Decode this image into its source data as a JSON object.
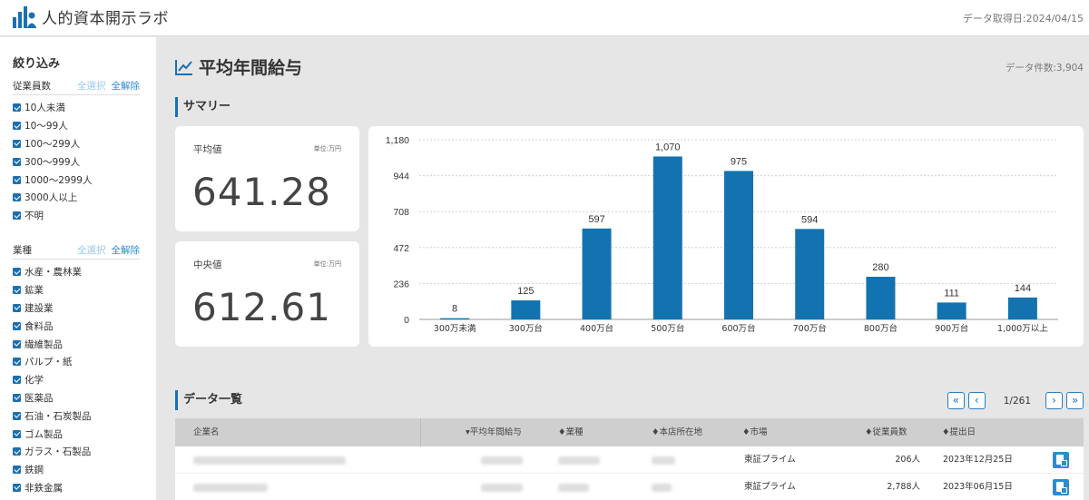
{
  "header": {
    "app_title": "人的資本開示ラボ",
    "fetch_date": "データ取得日:2024/04/15"
  },
  "sidebar": {
    "title": "絞り込み",
    "select_all": "全選択",
    "clear_all": "全解除",
    "filters": [
      {
        "name": "従業員数",
        "items": [
          "10人未満",
          "10〜99人",
          "100〜299人",
          "300〜999人",
          "1000〜2999人",
          "3000人以上",
          "不明"
        ]
      },
      {
        "name": "業種",
        "items": [
          "水産・農林業",
          "鉱業",
          "建設業",
          "食料品",
          "繊維製品",
          "パルプ・紙",
          "化学",
          "医薬品",
          "石油・石炭製品",
          "ゴム製品",
          "ガラス・石製品",
          "鉄鋼",
          "非鉄金属"
        ]
      }
    ]
  },
  "main": {
    "page_title": "平均年間給与",
    "data_count": "データ件数:3,904",
    "summary_title": "サマリー",
    "summary_cards": [
      {
        "label": "平均値",
        "unit": "単位:万円",
        "value": "641.28"
      },
      {
        "label": "中央値",
        "unit": "単位:万円",
        "value": "612.61"
      }
    ],
    "list_title": "データ一覧",
    "pager": {
      "info": "1/261",
      "first": "«",
      "prev": "‹",
      "next": "›",
      "last": "»"
    },
    "table": {
      "headers": [
        "企業名",
        "▾平均年間給与",
        "♦業種",
        "♦本店所在地",
        "♦市場",
        "♦従業員数",
        "♦提出日"
      ],
      "rows": [
        {
          "market": "東証プライム",
          "employees": "206人",
          "date": "2023年12月25日"
        },
        {
          "market": "東証プライム",
          "employees": "2,788人",
          "date": "2023年06月15日"
        }
      ]
    }
  },
  "chart_data": {
    "type": "bar",
    "categories": [
      "300万未満",
      "300万台",
      "400万台",
      "500万台",
      "600万台",
      "700万台",
      "800万台",
      "900万台",
      "1,000万以上"
    ],
    "values": [
      8,
      125,
      597,
      1070,
      975,
      594,
      280,
      111,
      144
    ],
    "yticks": [
      "0",
      "236",
      "472",
      "708",
      "944",
      "1,180"
    ],
    "ylim": [
      0,
      1180
    ],
    "grid": true,
    "color": "#1373b0"
  }
}
